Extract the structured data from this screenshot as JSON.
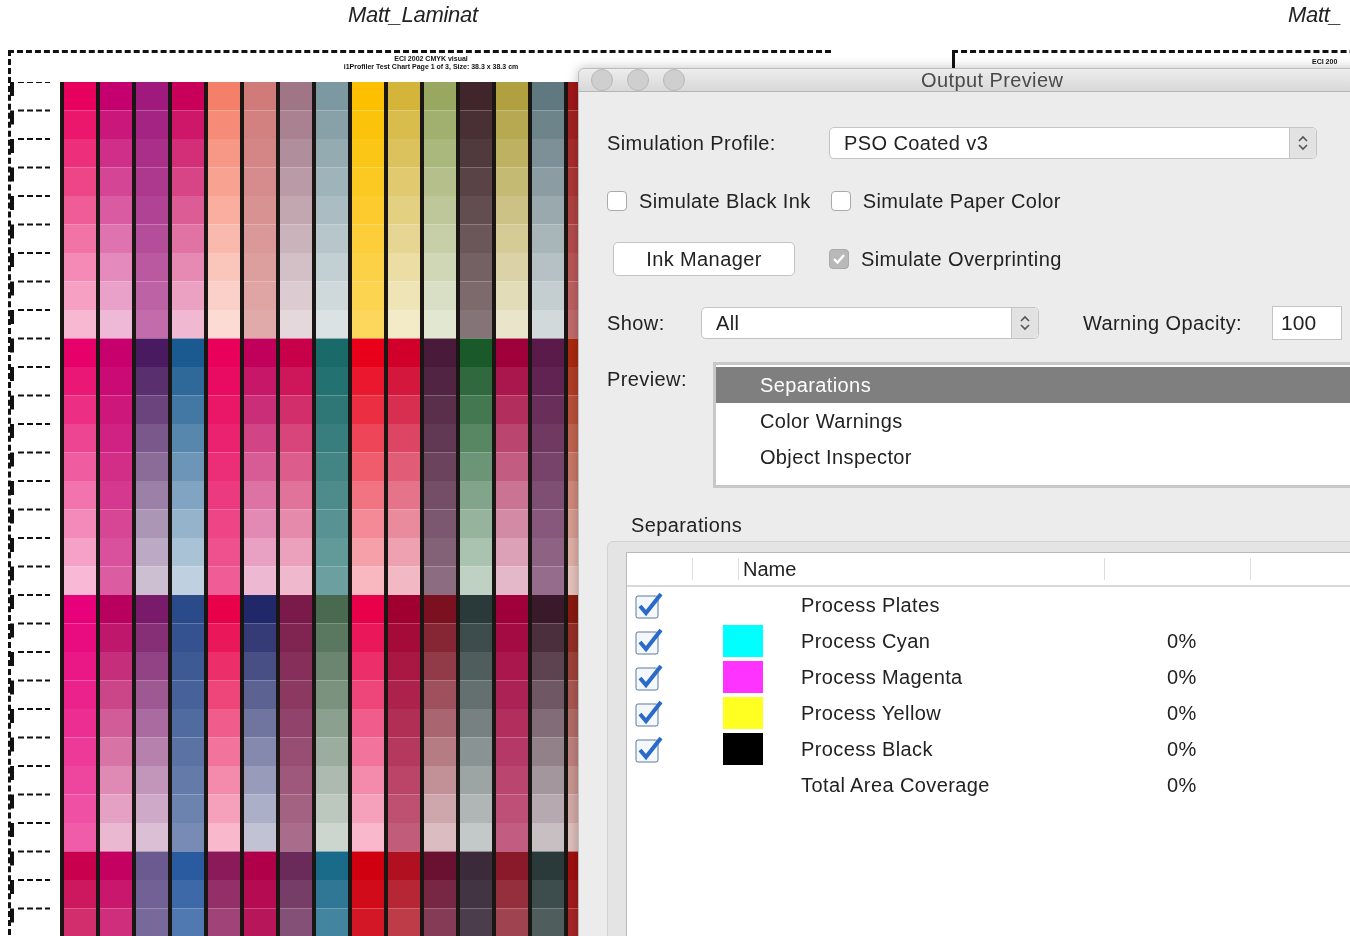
{
  "document": {
    "page_titles": [
      "Matt_Laminat",
      "Matt_"
    ],
    "chart_header": {
      "title": "ECI 2002 CMYK visual",
      "subtitle": "i1Profiler Test Chart Page 1 of 3, Size: 38.3 x 38.3 cm"
    },
    "second_header": "ECI 200"
  },
  "dialog": {
    "title": "Output Preview",
    "simulation_profile": {
      "label": "Simulation Profile:",
      "value": "PSO Coated v3"
    },
    "options": [
      {
        "label": "Simulate Black Ink",
        "checked": false
      },
      {
        "label": "Simulate Paper Color",
        "checked": false
      }
    ],
    "ink_manager_button": "Ink Manager",
    "overprinting": {
      "label": "Simulate Overprinting",
      "checked": true,
      "disabled": true
    },
    "show": {
      "label": "Show:",
      "value": "All"
    },
    "warning_opacity": {
      "label": "Warning Opacity:",
      "value": "100"
    },
    "preview": {
      "label": "Preview:",
      "items": [
        {
          "label": "Separations",
          "selected": true
        },
        {
          "label": "Color Warnings",
          "selected": false
        },
        {
          "label": "Object Inspector",
          "selected": false
        }
      ]
    },
    "separations": {
      "title": "Separations",
      "columns": [
        "Name"
      ],
      "rows": [
        {
          "name": "Process Plates",
          "checked": true,
          "kind": "plates"
        },
        {
          "name": "Process Cyan",
          "checked": true,
          "kind": "ink",
          "color": "#00ffff",
          "value": "0%"
        },
        {
          "name": "Process Magenta",
          "checked": true,
          "kind": "ink",
          "color": "#ff33ff",
          "value": "0%"
        },
        {
          "name": "Process Yellow",
          "checked": true,
          "kind": "ink",
          "color": "#ffff22",
          "value": "0%"
        },
        {
          "name": "Process Black",
          "checked": true,
          "kind": "ink",
          "color": "#000000",
          "value": "0%"
        },
        {
          "name": "Total Area Coverage",
          "kind": "total",
          "value": "0%"
        }
      ]
    }
  }
}
